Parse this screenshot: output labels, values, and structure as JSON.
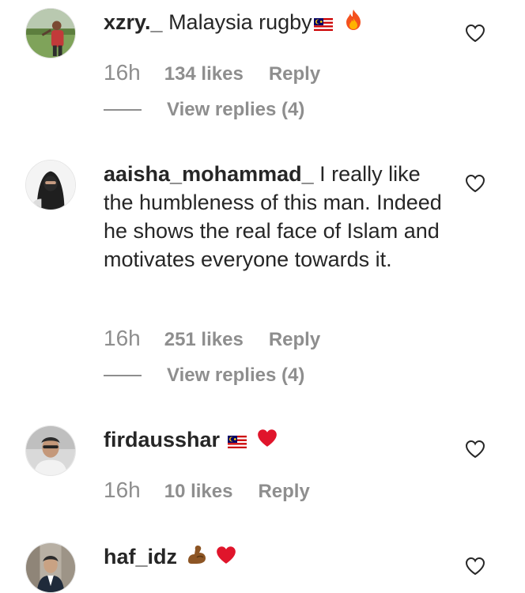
{
  "comments": [
    {
      "username": "xzry._",
      "text": " Malaysia rugby",
      "emojis": [
        "malaysia-flag",
        "fire"
      ],
      "time": "16h",
      "likes": "134 likes",
      "reply_label": "Reply",
      "view_replies": "View replies (4)"
    },
    {
      "username": "aaisha_mohammad_",
      "text": " I really like the humbleness of this man. Indeed he shows the real face of Islam and motivates everyone towards it.",
      "emojis": [],
      "time": "16h",
      "likes": "251 likes",
      "reply_label": "Reply",
      "view_replies": "View replies (4)"
    },
    {
      "username": "firdausshar",
      "text": " ",
      "emojis": [
        "malaysia-flag",
        "red-heart"
      ],
      "time": "16h",
      "likes": "10 likes",
      "reply_label": "Reply"
    },
    {
      "username": "haf_idz",
      "text": " ",
      "emojis": [
        "flexed-biceps",
        "red-heart"
      ]
    }
  ],
  "colors": {
    "text": "#262626",
    "muted": "#8e8e8e",
    "heart_emoji": "#e0152b",
    "like_icon_stroke": "#262626"
  }
}
